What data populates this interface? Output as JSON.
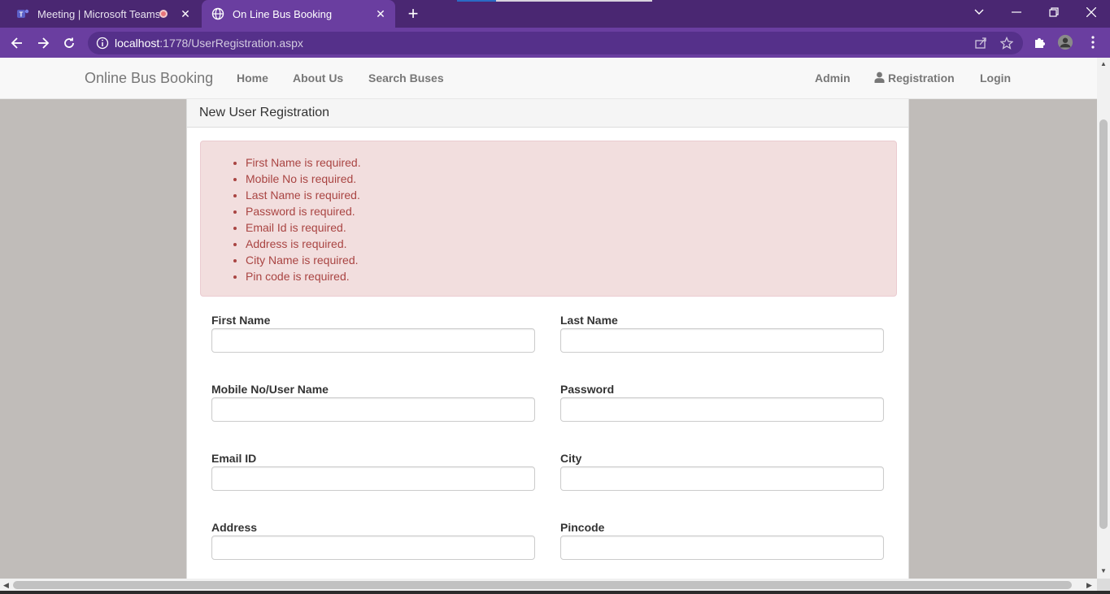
{
  "browser": {
    "tabs": [
      {
        "title": "Meeting | Microsoft Teams",
        "favicon": "teams-icon",
        "recording": true
      },
      {
        "title": "On Line Bus Booking",
        "favicon": "globe-icon",
        "active": true
      }
    ],
    "address_host": "localhost",
    "address_path": ":1778/UserRegistration.aspx",
    "colors": {
      "frame": "#4a2772",
      "toolbar": "#6a3ea0",
      "omnibox": "#55308a"
    }
  },
  "navbar": {
    "brand": "Online Bus Booking",
    "links": {
      "home": "Home",
      "about": "About Us",
      "search": "Search Buses",
      "admin": "Admin",
      "registration": "Registration",
      "login": "Login"
    }
  },
  "panel": {
    "heading": "New User Registration"
  },
  "errors": [
    "First Name is required.",
    "Mobile No is required.",
    "Last Name is required.",
    "Password is required.",
    "Email Id is required.",
    "Address is required.",
    "City Name is required.",
    "Pin code is required."
  ],
  "form": {
    "first_name": {
      "label": "First Name",
      "value": ""
    },
    "last_name": {
      "label": "Last Name",
      "value": ""
    },
    "mobile": {
      "label": "Mobile No/User Name",
      "value": ""
    },
    "password": {
      "label": "Password",
      "value": ""
    },
    "email": {
      "label": "Email ID",
      "value": ""
    },
    "city": {
      "label": "City",
      "value": ""
    },
    "address": {
      "label": "Address",
      "value": ""
    },
    "pincode": {
      "label": "Pincode",
      "value": ""
    }
  },
  "theme": {
    "error_text": "#a94442",
    "error_bg": "#f2dede",
    "page_bg": "#c0bcb9"
  }
}
